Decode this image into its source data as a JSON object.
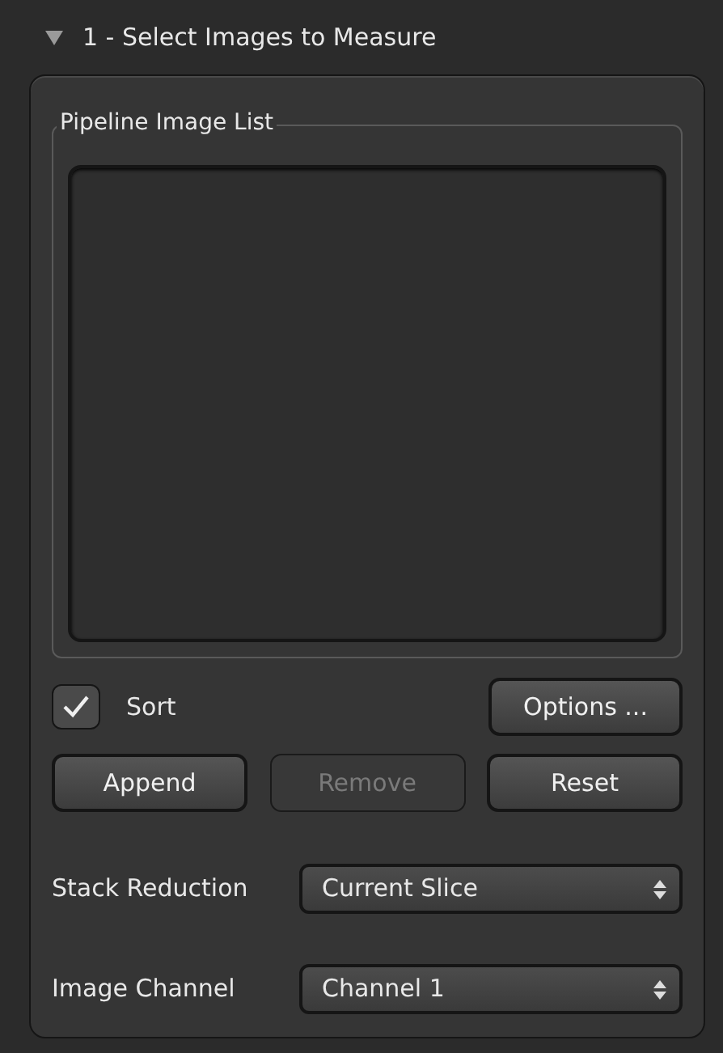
{
  "section": {
    "title": "1 - Select Images to Measure",
    "expanded": true
  },
  "image_list": {
    "title": "Pipeline Image List"
  },
  "sort": {
    "label": "Sort",
    "checked": true
  },
  "buttons": [
    {
      "label": "Options ...",
      "disabled": false
    }
  ],
  "list_buttons": [
    {
      "label": "Append",
      "disabled": false
    },
    {
      "label": "Remove",
      "disabled": true
    },
    {
      "label": "Reset",
      "disabled": false
    }
  ],
  "fields": [
    {
      "label": "Stack Reduction",
      "value": "Current Slice"
    },
    {
      "label": "Image Channel",
      "value": "Channel 1"
    }
  ]
}
